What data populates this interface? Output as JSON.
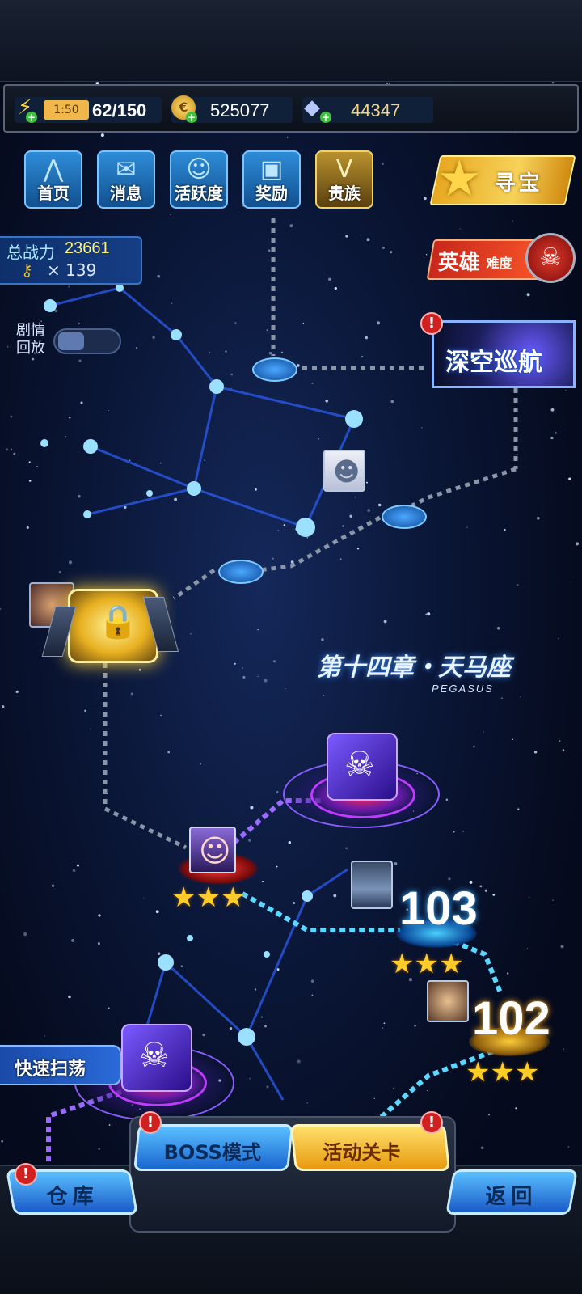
{
  "resources": {
    "energy_timer": "1:50",
    "energy": "62/150",
    "coins": "525077",
    "diamonds": "44347"
  },
  "nav": [
    {
      "label": "首页",
      "icon": "home-icon"
    },
    {
      "label": "消息",
      "icon": "mail-icon"
    },
    {
      "label": "活跃度",
      "icon": "smile-icon"
    },
    {
      "label": "奖励",
      "icon": "gift-icon"
    },
    {
      "label": "贵族",
      "icon": "v-badge-icon"
    }
  ],
  "treasure_label": "寻宝",
  "power": {
    "label": "总战力",
    "value": "23661",
    "keys_label": "× 139"
  },
  "hero_difficulty": {
    "label1": "英雄",
    "label2": "难度"
  },
  "replay": {
    "line1": "剧情",
    "line2": "回放"
  },
  "deep_space": "深空巡航",
  "chapter": {
    "title": "第十四章・天马座",
    "subtitle": "PEGASUS"
  },
  "stages": {
    "s103": "103",
    "s102": "102"
  },
  "badge_mark": "!",
  "quick_sweep": "快速扫荡",
  "boss_mode": "BOSS模式",
  "event_stage": "活动关卡",
  "warehouse": "仓库",
  "back": "返回",
  "colors": {
    "accent": "#2e8cd8",
    "gold": "#f2c230",
    "star": "#ffcc2a",
    "path_cyan": "#5ad8ff",
    "path_purple": "#9b6bff"
  }
}
